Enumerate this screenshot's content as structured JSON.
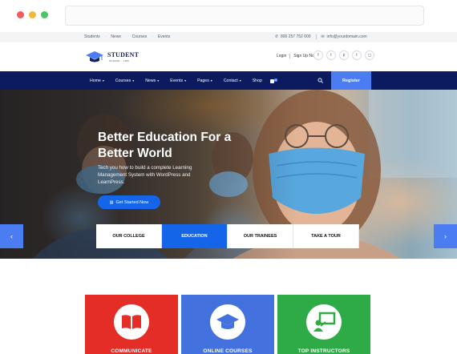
{
  "browser": {
    "window_controls": [
      "close",
      "minimize",
      "maximize"
    ]
  },
  "topbar": {
    "links": [
      "Students",
      "News",
      "Courses",
      "Events"
    ],
    "phone": "800 257 752 000",
    "email": "info@yourdomain.com"
  },
  "header": {
    "logo_word": "STUDENT",
    "logo_tagline": "SCHOOL · LMS",
    "login": "Login",
    "signup": "Sign Up Now",
    "socials": [
      "facebook",
      "twitter",
      "pinterest",
      "tumblr",
      "instagram"
    ]
  },
  "nav": {
    "items": [
      {
        "label": "Home",
        "dropdown": true
      },
      {
        "label": "Courses",
        "dropdown": true
      },
      {
        "label": "News",
        "dropdown": true
      },
      {
        "label": "Events",
        "dropdown": true
      },
      {
        "label": "Pages",
        "dropdown": true
      },
      {
        "label": "Contact",
        "dropdown": true
      },
      {
        "label": "Shop",
        "dropdown": false
      }
    ],
    "cart_count": "0",
    "register": "Register"
  },
  "hero": {
    "title": "Better Education For a Better World",
    "subtitle": "Tech you how to build a complete Learning Management System with WordPress and LearnPress.",
    "cta": "Get Started Now",
    "tabs": [
      "OUR COLLEGE",
      "EDUCATION",
      "OUR TRAINEES",
      "TAKE A TOUR"
    ],
    "active_tab": "EDUCATION"
  },
  "features": [
    {
      "label": "COMMUNICATE",
      "icon": "book-icon",
      "color": "#e52d27"
    },
    {
      "label": "ONLINE COURSES",
      "icon": "graduation-cap-icon",
      "color": "#4371dd"
    },
    {
      "label": "TOP INSTRUCTORS",
      "icon": "teacher-board-icon",
      "color": "#2eaa46"
    }
  ],
  "colors": {
    "nav_bg": "#0c1b5f",
    "accent_blue": "#1565e8",
    "register_blue": "#4c7cf2"
  }
}
